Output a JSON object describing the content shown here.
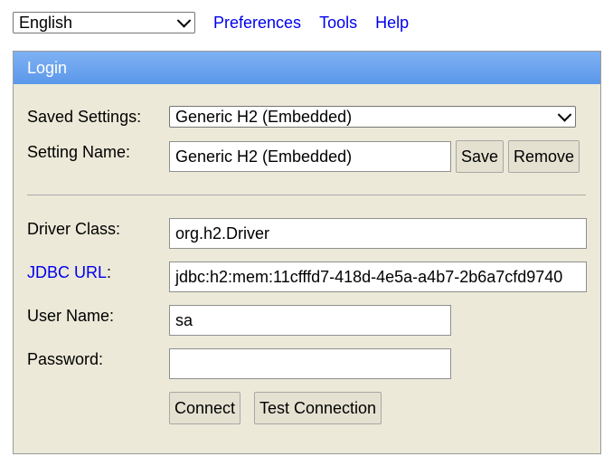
{
  "topbar": {
    "language_selected": "English",
    "links": {
      "preferences": "Preferences",
      "tools": "Tools",
      "help": "Help"
    }
  },
  "login": {
    "title": "Login",
    "saved_settings": {
      "label": "Saved Settings:",
      "selected": "Generic H2 (Embedded)"
    },
    "setting_name": {
      "label": "Setting Name:",
      "value": "Generic H2 (Embedded)",
      "save_label": "Save",
      "remove_label": "Remove"
    },
    "driver_class": {
      "label": "Driver Class:",
      "value": "org.h2.Driver"
    },
    "jdbc_url": {
      "label_link": "JDBC URL",
      "label_suffix": ":",
      "value": "jdbc:h2:mem:11cfffd7-418d-4e5a-a4b7-2b6a7cfd9740"
    },
    "user_name": {
      "label": "User Name:",
      "value": "sa"
    },
    "password": {
      "label": "Password:",
      "value": ""
    },
    "buttons": {
      "connect": "Connect",
      "test_connection": "Test Connection"
    }
  },
  "colors": {
    "header_gradient_top": "#7fb1f3",
    "header_gradient_bottom": "#5a98ea",
    "panel_background": "#ece9d8",
    "link": "#0000ee"
  }
}
